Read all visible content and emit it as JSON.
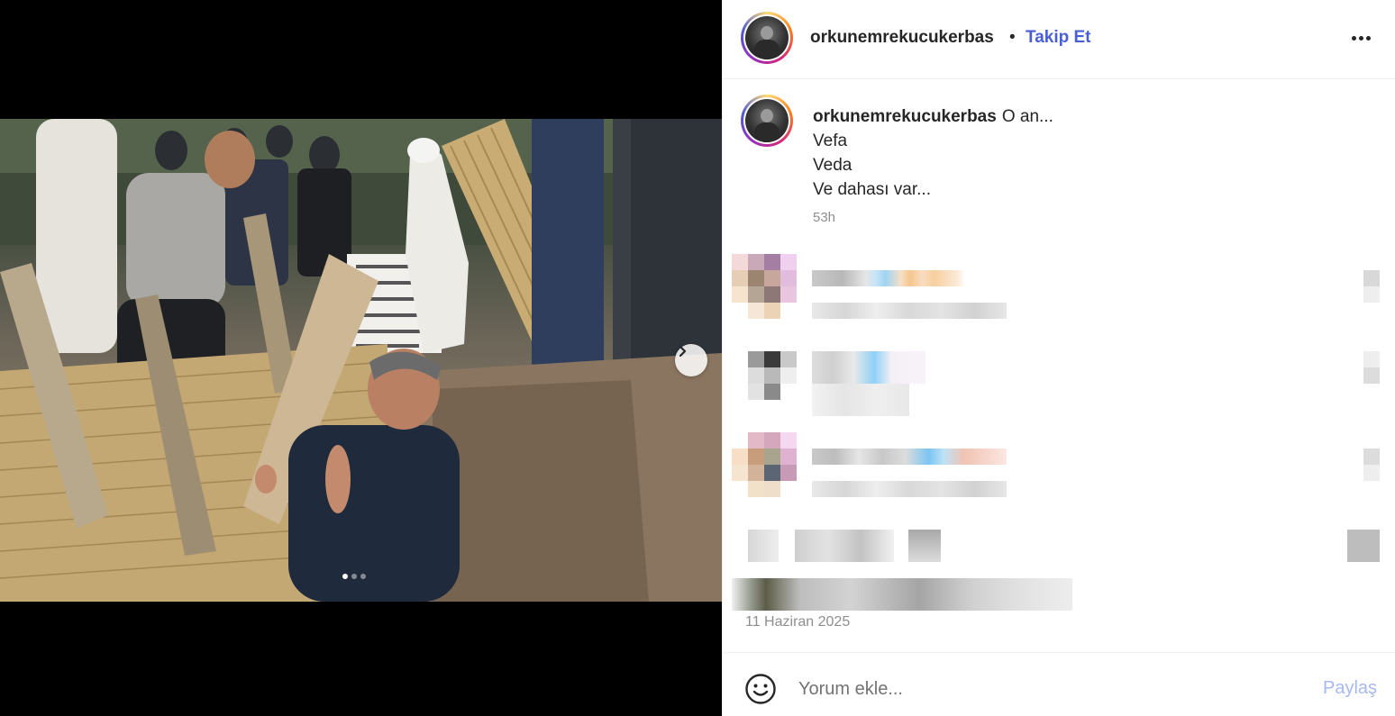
{
  "post": {
    "username": "orkunemrekucukerbas",
    "separator": "•",
    "follow_label": "Takip Et",
    "caption_lines": [
      "O an...",
      "Vefa",
      "Veda",
      "Ve dahası var..."
    ],
    "caption_time": "53h",
    "date": "11 Haziran 2025",
    "carousel": {
      "count": 3,
      "active_index": 0
    }
  },
  "footer": {
    "comment_placeholder": "Yorum ekle...",
    "post_label": "Paylaş"
  },
  "icons": {
    "more": "more-horizontal-icon",
    "next": "chevron-right-icon",
    "emoji": "smiley-icon"
  },
  "colors": {
    "follow": "#4a5fd6",
    "post_disabled": "#a6b9f0",
    "muted_text": "#8e8e8e"
  }
}
